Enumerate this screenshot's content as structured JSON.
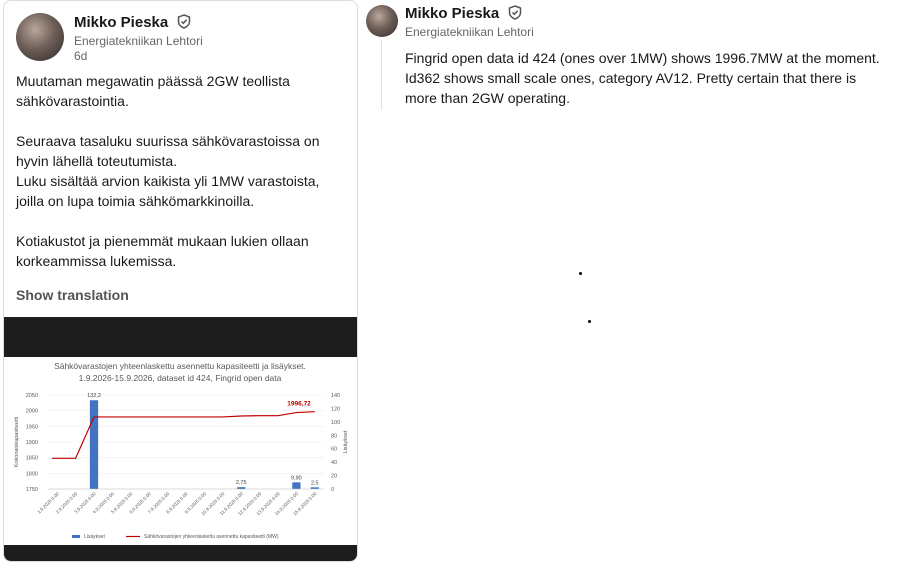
{
  "post": {
    "author": "Mikko Pieska",
    "headline": "Energiatekniikan Lehtori",
    "time": "6d",
    "text": "Muutaman megawatin päässä 2GW teollista sähkövarastointia.\n\nSeuraava tasaluku suurissa sähkövarastoissa on hyvin lähellä toteutumista.\nLuku sisältää arvion kaikista yli 1MW varastoista, joilla on lupa toimia sähkömarkkinoilla.\n\nKotiakustot ja pienemmät mukaan lukien ollaan korkeammissa lukemissa.",
    "show_translation": "Show translation"
  },
  "comment": {
    "author": "Mikko Pieska",
    "headline": "Energiatekniikan Lehtori",
    "text": "Fingrid open data id 424 (ones over 1MW) shows 1996.7MW at the moment. Id362 shows small scale ones, category AV12. Pretty certain that there is more than 2GW operating."
  },
  "colors": {
    "bar": "#4472c4",
    "line": "#c00000",
    "muted": "#666666"
  },
  "chart_data": {
    "type": "bar",
    "title": "Sähkövarastojen yhteenlaskettu asennettu kapasiteetti ja lisäykset.\n1.9.2026-15.9.2026, dataset id 424, Fingrid open data",
    "ylabel": "Kokonaiskapasiteetti",
    "y2label": "Lisäykset",
    "ylim": [
      1750,
      2050
    ],
    "y2lim": [
      0,
      140
    ],
    "yticks": [
      "2050",
      "2000",
      "1950",
      "1900",
      "1850",
      "1800",
      "1750"
    ],
    "y2ticks": [
      "140",
      "120",
      "100",
      "80",
      "60",
      "40",
      "20",
      "0"
    ],
    "categories": [
      "1.9.2026 0.00",
      "2.9.2026 0.00",
      "3.9.2026 0.00",
      "4.9.2026 0.00",
      "5.9.2026 0.00",
      "6.9.2026 0.00",
      "7.9.2026 0.00",
      "8.9.2026 0.00",
      "9.9.2026 0.00",
      "10.9.2026 0.00",
      "11.9.2026 0.00",
      "12.9.2026 0.00",
      "13.9.2026 0.00",
      "14.9.2026 0.00",
      "15.9.2026 0.00"
    ],
    "series": [
      {
        "name": "Lisäykset",
        "type": "bar",
        "axis": "right",
        "values": [
          0,
          0,
          132.2,
          0,
          0,
          0,
          0,
          0,
          0,
          0,
          2.75,
          0,
          0,
          9.9,
          2.5
        ],
        "labels": [
          "",
          "",
          "132,2",
          "",
          "",
          "",
          "",
          "",
          "",
          "",
          "2,75",
          "",
          "",
          "9,90",
          "2,5"
        ]
      },
      {
        "name": "Sähkövarastojen yhteenlaskettu asennettu kapasiteetti (MW)",
        "type": "line",
        "axis": "left",
        "values": [
          1848,
          1848,
          1980,
          1980,
          1980,
          1980,
          1980,
          1980,
          1980,
          1980,
          1983,
          1984,
          1984,
          1994,
          1996.72
        ]
      }
    ],
    "annotation": "1996,72",
    "legend_position": "bottom"
  }
}
